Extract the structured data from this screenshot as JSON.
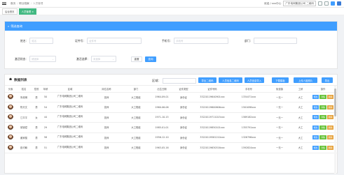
{
  "topbar": {
    "breadcrumb": [
      "首页",
      "职业档案",
      "人员管理"
    ],
    "right_text": "欢迎 / xxx中心",
    "org_select": "广东电网集团公司 二维码"
  },
  "tabs": [
    {
      "label": "后台首页",
      "active": false
    },
    {
      "label": "人员管理 ×",
      "active": true
    }
  ],
  "search": {
    "title": "筛选查询",
    "name_label": "姓名：",
    "name_placeholder": "姓名",
    "id_label": "证件号：",
    "id_placeholder": "证件号",
    "phone_label": "手机号：",
    "phone_placeholder": "手机号",
    "dept_label": "部门：",
    "dept_placeholder": "",
    "status_label": "激活状态：",
    "status_placeholder": "请选择",
    "type_label": "激活选择：",
    "type_placeholder": "未选择",
    "reset_label": "重置",
    "query_label": "查询"
  },
  "list": {
    "title": "数据列表",
    "area_label": "区域：",
    "buttons": [
      "导出二维码",
      "人员信息二维码",
      "人员信息导入",
      "下载模板",
      "上传人脸照片",
      "导出"
    ],
    "columns": [
      "头像",
      "姓名",
      "性别",
      "年龄",
      "区域",
      "岗位名称",
      "部门",
      "出生日期",
      "证件类型",
      "证件号码",
      "手机号",
      "街道镇",
      "工龄",
      "操作"
    ],
    "actions": [
      "修改",
      "详情",
      "删除"
    ],
    "rows": [
      {
        "name": "朱政琳",
        "gender": "男",
        "age": "50",
        "area": "广东电网集团公司二维码",
        "job": "技师",
        "dept": "大工程组",
        "birth": "1964-09-01",
        "idtype": "身份证",
        "idno": "33220119640901xxx",
        "phone": "1334471xxx",
        "street": "一无一",
        "years": "大工"
      },
      {
        "name": "陈天文",
        "gender": "男",
        "age": "54",
        "area": "广东电网集团公司二维码",
        "job": "技师",
        "dept": "大工程组",
        "birth": "1960-06-06",
        "idtype": "身份证",
        "idno": "33220119600606xxx",
        "phone": "1501098xxx",
        "street": "一无一",
        "years": "大工"
      },
      {
        "name": "江平平",
        "gender": "女",
        "age": "44",
        "area": "广东电网集团公司二维码",
        "job": "技师",
        "dept": "大工程组",
        "birth": "1971-10-15",
        "idtype": "身份证",
        "idno": "33220119711015xxx",
        "phone": "1589182xxx",
        "street": "一无一",
        "years": "大工"
      },
      {
        "name": "胡锦斌",
        "gender": "男",
        "age": "29",
        "area": "广东电网集团公司二维码",
        "job": "技师",
        "dept": "大工程组",
        "birth": "1985-01-01",
        "idtype": "身份证",
        "idno": "33220119850101xxx",
        "phone": "1355791xxx",
        "street": "一无一",
        "years": "大工"
      },
      {
        "name": "姜家骏",
        "gender": "男",
        "age": "58",
        "area": "广东电网集团公司二维码",
        "job": "技师",
        "dept": "大工程组",
        "birth": "1956-12-10",
        "idtype": "身份证",
        "idno": "33220119561210xxx",
        "phone": "1326796xxx",
        "street": "一无一",
        "years": "大工"
      },
      {
        "name": "彭约翰",
        "gender": "男",
        "age": "51",
        "area": "广东电网集团公司二维码",
        "job": "技师",
        "dept": "大工程组",
        "birth": "1963-05-16",
        "idtype": "身份证",
        "idno": "33220119630516xxx",
        "phone": "1592824xxx",
        "street": "一无一",
        "years": "大工"
      }
    ]
  }
}
